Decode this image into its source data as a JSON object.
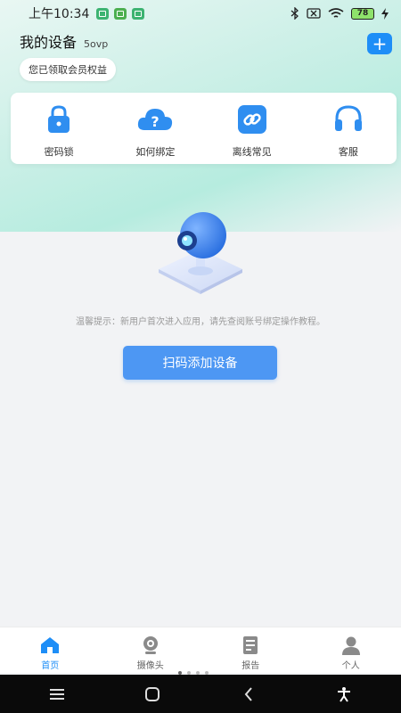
{
  "status_bar": {
    "time": "上午10:34",
    "battery": "78"
  },
  "header": {
    "title": "我的设备",
    "subtitle": "5ovp",
    "add_label": "+"
  },
  "member_pill": "您已领取会员权益",
  "quick_actions": [
    {
      "label": "密码锁",
      "icon": "lock-icon"
    },
    {
      "label": "如何绑定",
      "icon": "help-cloud-icon"
    },
    {
      "label": "离线常见",
      "icon": "link-icon"
    },
    {
      "label": "客服",
      "icon": "headset-icon"
    }
  ],
  "hero": {
    "icon": "webcam-icon"
  },
  "tip_text": "温馨提示：新用户首次进入应用，请先查阅账号绑定操作教程。",
  "scan_button": "扫码添加设备",
  "tabs": [
    {
      "label": "首页",
      "icon": "home-icon",
      "active": true
    },
    {
      "label": "摄像头",
      "icon": "camera-icon",
      "active": false
    },
    {
      "label": "报告",
      "icon": "report-icon",
      "active": false
    },
    {
      "label": "个人",
      "icon": "person-icon",
      "active": false
    }
  ],
  "nav_bar": {
    "icons": [
      "menu-icon",
      "home-square-icon",
      "back-icon",
      "accessibility-icon"
    ]
  },
  "colors": {
    "accent": "#1e8ef7",
    "button": "#4d97f3",
    "gradient_top": "#b6ecdf"
  }
}
